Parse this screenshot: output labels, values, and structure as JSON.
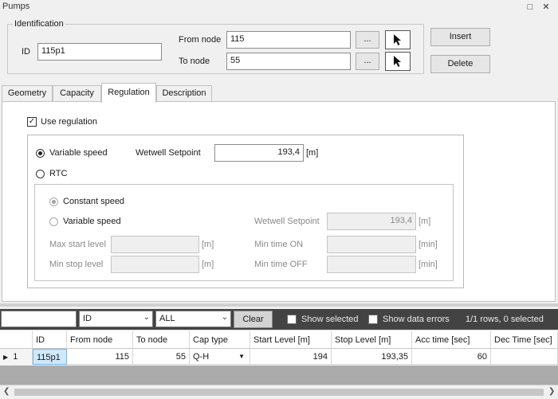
{
  "window": {
    "title": "Pumps",
    "restore_icon": "restore-icon",
    "close_icon": "close-icon"
  },
  "identification": {
    "legend": "Identification",
    "id_label": "ID",
    "id_value": "115p1",
    "from_node_label": "From node",
    "from_node_value": "115",
    "to_node_label": "To node",
    "to_node_value": "55",
    "browse_label": "...",
    "pick_icon": "cursor-arrow-icon"
  },
  "actions": {
    "insert_label": "Insert",
    "delete_label": "Delete"
  },
  "tabs": [
    {
      "label": "Geometry"
    },
    {
      "label": "Capacity"
    },
    {
      "label": "Regulation"
    },
    {
      "label": "Description"
    }
  ],
  "active_tab": "Regulation",
  "regulation": {
    "use_regulation_label": "Use regulation",
    "use_regulation_checked": true,
    "variable_speed_label": "Variable speed",
    "variable_speed_selected": true,
    "wetwell_setpoint_label": "Wetwell Setpoint",
    "wetwell_setpoint_value": "193,4",
    "unit_m": "[m]",
    "rtc_label": "RTC",
    "rtc_selected": false,
    "rtc": {
      "constant_speed_label": "Constant speed",
      "constant_speed_selected": true,
      "variable_speed_label": "Variable speed",
      "wetwell_setpoint_label": "Wetwell Setpoint",
      "wetwell_setpoint_value": "193,4",
      "unit_m": "[m]",
      "max_start_level_label": "Max start level",
      "max_start_level_value": "",
      "min_stop_level_label": "Min stop level",
      "min_stop_level_value": "",
      "min_time_on_label": "Min time ON",
      "min_time_on_value": "",
      "min_time_off_label": "Min time OFF",
      "min_time_off_value": "",
      "unit_min": "[min]"
    }
  },
  "filter": {
    "search_value": "",
    "field_select": "ID",
    "scope_select": "ALL",
    "clear_label": "Clear",
    "show_selected_label": "Show selected",
    "show_data_errors_label": "Show data errors",
    "status": "1/1 rows, 0 selected"
  },
  "grid": {
    "columns": [
      "ID",
      "From node",
      "To node",
      "Cap type",
      "Start Level [m]",
      "Stop Level [m]",
      "Acc time [sec]",
      "Dec Time [sec]"
    ],
    "rows": [
      {
        "row_number": "1",
        "id": "115p1",
        "from_node": "115",
        "to_node": "55",
        "cap_type": "Q-H",
        "start_level": "194",
        "stop_level": "193,35",
        "acc_time": "60",
        "dec_time": ""
      }
    ]
  },
  "colors": {
    "selected_cell": "#cfe8fc",
    "filter_bar": "#434343",
    "empty_grid": "#ababab"
  }
}
